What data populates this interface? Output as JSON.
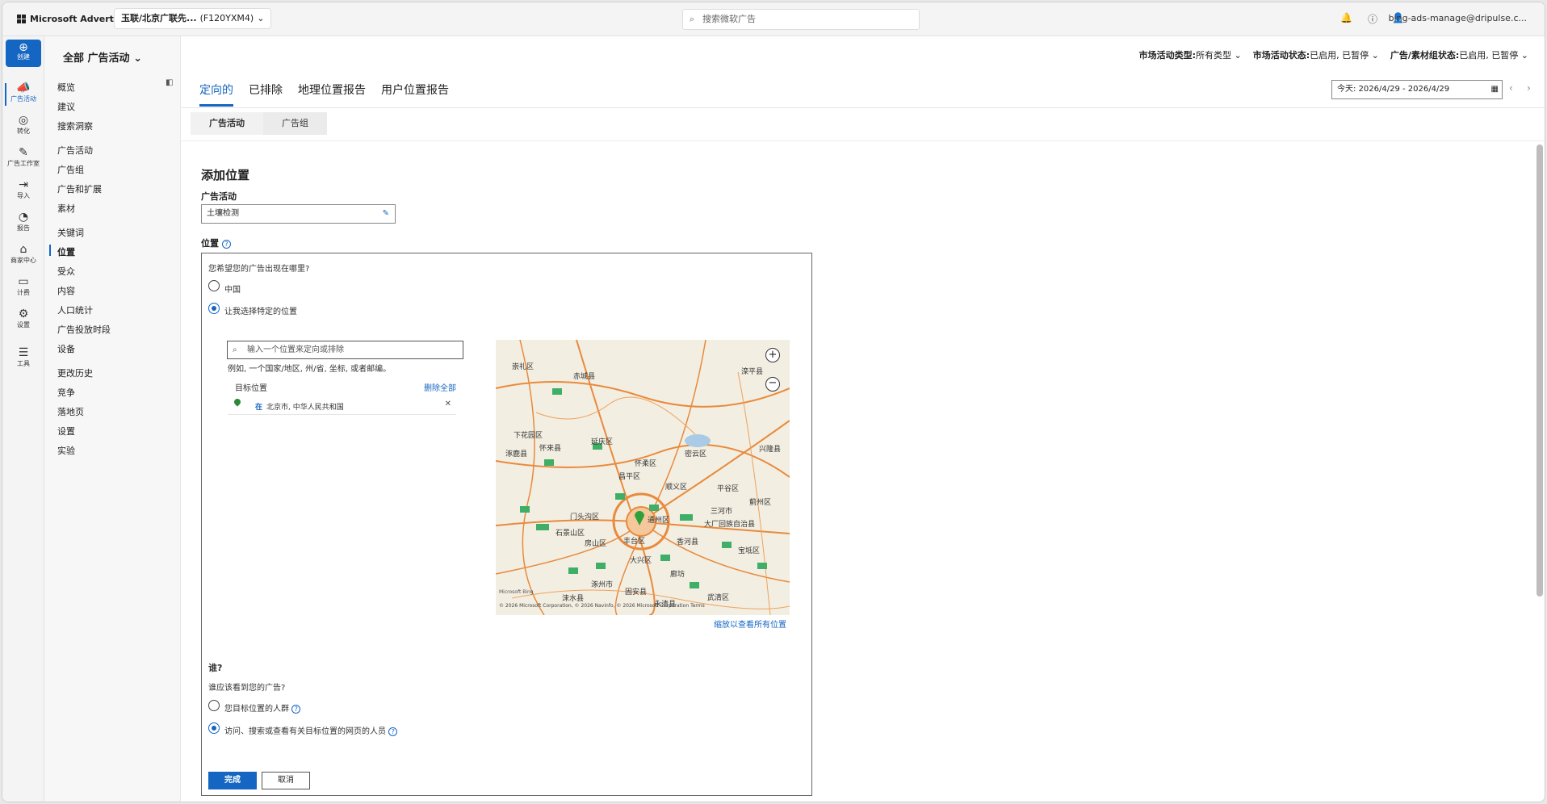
{
  "topbar": {
    "brand": "Microsoft Advertising",
    "account_name": "玉联/北京广联先...",
    "account_id": "(F120YXM4)",
    "search_placeholder": "搜索微软广告",
    "user": "bing-ads-manage@dripulse.c..."
  },
  "leftnav": {
    "create": "创建",
    "items": [
      {
        "label": "广告活动",
        "icon": "megaphone-icon"
      },
      {
        "label": "转化",
        "icon": "target-icon"
      },
      {
        "label": "广告工作室",
        "icon": "image-edit-icon"
      },
      {
        "label": "导入",
        "icon": "import-icon"
      },
      {
        "label": "报告",
        "icon": "report-icon"
      },
      {
        "label": "商家中心",
        "icon": "store-icon"
      },
      {
        "label": "计费",
        "icon": "wallet-icon"
      },
      {
        "label": "设置",
        "icon": "gear-icon"
      },
      {
        "label": "工具",
        "icon": "tools-icon"
      }
    ]
  },
  "sidebar": {
    "items": [
      "概览",
      "建议",
      "搜索洞察",
      "广告活动",
      "广告组",
      "广告和扩展",
      "素材",
      "关键词",
      "位置",
      "受众",
      "内容",
      "人口统计",
      "广告投放时段",
      "设备",
      "更改历史",
      "竞争",
      "落地页",
      "设置",
      "实验"
    ],
    "active": "位置"
  },
  "header": {
    "scope": "全部 广告活动",
    "filters": [
      {
        "label": "市场活动类型:",
        "value": "所有类型"
      },
      {
        "label": "市场活动状态:",
        "value": "已启用, 已暂停"
      },
      {
        "label": "广告/素材组状态:",
        "value": "已启用, 已暂停"
      }
    ]
  },
  "tabs": [
    "定向的",
    "已排除",
    "地理位置报告",
    "用户位置报告"
  ],
  "date_range": "今天: 2026/4/29 - 2026/4/29",
  "subtabs": [
    "广告活动",
    "广告组"
  ],
  "form": {
    "title": "添加位置",
    "campaign_label": "广告活动",
    "campaign_value": "土壤检测",
    "location_label": "位置",
    "where_question": "您希望您的广告出现在哪里?",
    "option_china": "中国",
    "option_specific": "让我选择特定的位置",
    "search_placeholder": "输入一个位置来定向或排除",
    "search_hint": "例如, 一个国家/地区, 州/省, 坐标, 或者邮编。",
    "target_header": "目标位置",
    "delete_all": "删除全部",
    "target_in": "在",
    "target_name": "北京市, 中华人民共和国",
    "zoom_link": "缩放以查看所有位置",
    "who_title": "谁?",
    "who_question": "谁应该看到您的广告?",
    "who_opt1": "您目标位置的人群",
    "who_opt2": "访问、搜索或查看有关目标位置的网页的人员",
    "done": "完成",
    "cancel": "取消"
  },
  "map": {
    "labels": [
      "崇礼区",
      "赤城县",
      "滦平县",
      "下花园区",
      "延庆区",
      "怀来县",
      "涿鹿县",
      "密云区",
      "兴隆县",
      "怀柔区",
      "昌平区",
      "顺义区",
      "平谷区",
      "门头沟区",
      "通州区",
      "三河市",
      "蓟州区",
      "石景山区",
      "丰台区",
      "大厂回族自治县",
      "房山区",
      "大兴区",
      "香河县",
      "宝坻区",
      "涿州市",
      "廊坊",
      "固安县",
      "武清区",
      "永清县",
      "涞水县"
    ],
    "attribution": "© 2026 Microsoft Corporation, © 2026 Navinfo, © 2026 Microsoft Corporation  Terms",
    "bing": "Microsoft Bing"
  }
}
